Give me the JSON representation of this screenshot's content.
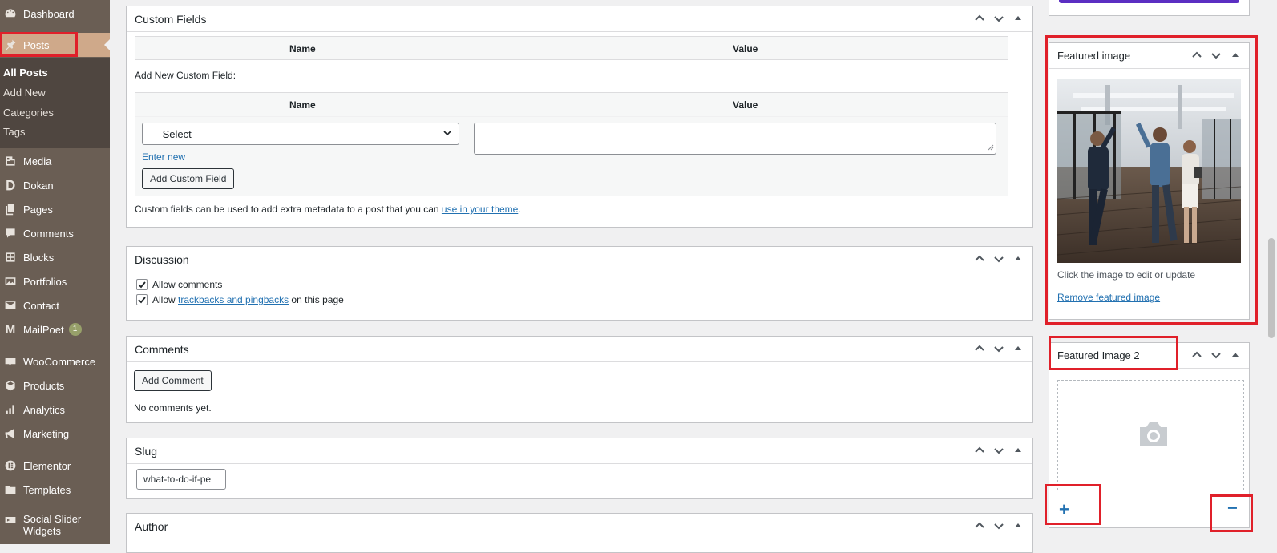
{
  "sidebar": {
    "dashboard": "Dashboard",
    "posts": "Posts",
    "submenu": [
      "All Posts",
      "Add New",
      "Categories",
      "Tags"
    ],
    "media": "Media",
    "dokan": "Dokan",
    "pages": "Pages",
    "comments": "Comments",
    "blocks": "Blocks",
    "portfolios": "Portfolios",
    "contact": "Contact",
    "mailpoet": "MailPoet",
    "mailpoet_count": "1",
    "woocommerce": "WooCommerce",
    "products": "Products",
    "analytics": "Analytics",
    "marketing": "Marketing",
    "elementor": "Elementor",
    "templates": "Templates",
    "social_slider": "Social Slider Widgets"
  },
  "custom_fields": {
    "title": "Custom Fields",
    "col_name": "Name",
    "col_value": "Value",
    "add_new_label": "Add New Custom Field:",
    "select_placeholder": "— Select —",
    "enter_new": "Enter new",
    "add_button": "Add Custom Field",
    "note_prefix": "Custom fields can be used to add extra metadata to a post that you can ",
    "note_link": "use in your theme",
    "note_suffix": "."
  },
  "discussion": {
    "title": "Discussion",
    "allow_comments": "Allow comments",
    "allow_prefix": "Allow ",
    "trackbacks_link": "trackbacks and pingbacks",
    "allow_suffix": " on this page",
    "allow_comments_checked": true,
    "allow_pings_checked": true
  },
  "comments_box": {
    "title": "Comments",
    "add_button": "Add Comment",
    "empty": "No comments yet."
  },
  "slug": {
    "title": "Slug",
    "value": "what-to-do-if-pe"
  },
  "author": {
    "title": "Author"
  },
  "featured_image": {
    "title": "Featured image",
    "hint": "Click the image to edit or update",
    "remove_link": "Remove featured image"
  },
  "featured_image_2": {
    "title": "Featured Image 2",
    "add_symbol": "+",
    "remove_symbol": "−"
  },
  "colors": {
    "sidebar_bg": "#6a5e54",
    "posts_highlight": "#cfa98a",
    "annotation_red": "#e0202a",
    "purple_button": "#5b2ec2",
    "link_blue": "#2271b1"
  }
}
